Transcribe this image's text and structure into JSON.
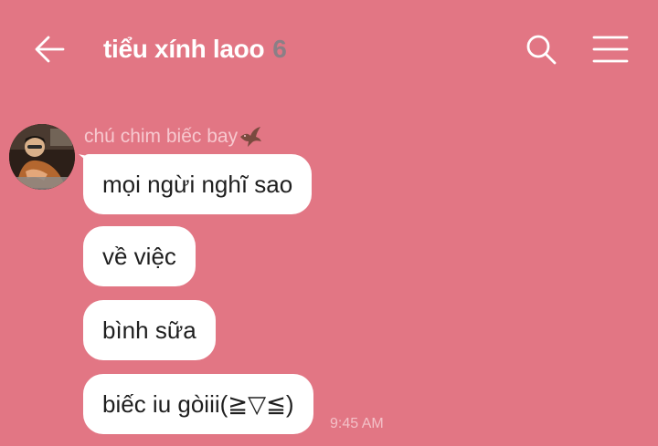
{
  "header": {
    "title": "tiểu xính laoo",
    "member_count": "6",
    "back_icon": "arrow-left-icon",
    "search_icon": "search-icon",
    "menu_icon": "hamburger-menu-icon"
  },
  "message_group": {
    "sender_name": "chú chim biếc bay",
    "sender_icon": "bird-icon",
    "messages": [
      {
        "text": "mọi ngừi nghĩ sao"
      },
      {
        "text": "về việc"
      },
      {
        "text": "bình sữa"
      },
      {
        "text": "biếc iu gòiii(≧▽≦)"
      }
    ],
    "time": "9:45 AM"
  },
  "colors": {
    "background": "#e27684",
    "bubble": "#ffffff",
    "title_text": "#ffffff",
    "member_count": "#8b7f86",
    "sender_name": "#f7c8cf"
  }
}
